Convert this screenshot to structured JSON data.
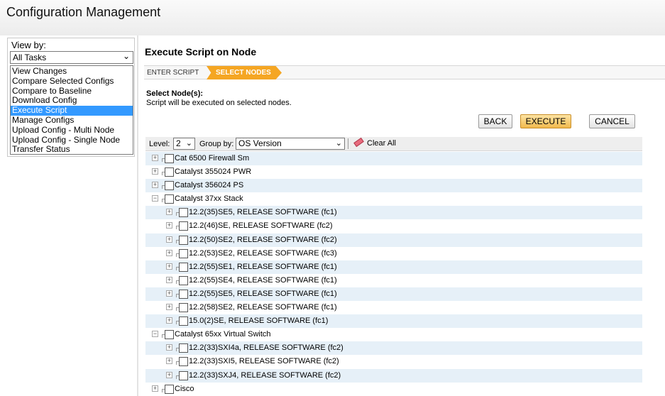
{
  "header": {
    "title": "Configuration Management"
  },
  "view_by": {
    "label": "View by:",
    "selected": "All Tasks",
    "items": [
      {
        "label": "View Changes",
        "selected": false
      },
      {
        "label": "Compare Selected Configs",
        "selected": false
      },
      {
        "label": "Compare to Baseline",
        "selected": false
      },
      {
        "label": "Download Config",
        "selected": false
      },
      {
        "label": "Execute Script",
        "selected": true
      },
      {
        "label": "Manage Configs",
        "selected": false
      },
      {
        "label": "Upload Config - Multi Node",
        "selected": false
      },
      {
        "label": "Upload Config - Single Node",
        "selected": false
      },
      {
        "label": "Transfer Status",
        "selected": false
      }
    ]
  },
  "main": {
    "title": "Execute Script on Node",
    "steps": [
      "ENTER SCRIPT",
      "SELECT NODES"
    ],
    "select_heading": "Select Node(s):",
    "select_sub": "Script will be executed on selected nodes.",
    "buttons": {
      "back": "BACK",
      "execute": "EXECUTE",
      "cancel": "CANCEL"
    },
    "toolbar": {
      "level_label": "Level:",
      "level_value": "2",
      "group_label": "Group by:",
      "group_value": "OS Version",
      "clear_label": "Clear All"
    }
  },
  "tree": [
    {
      "label": "Cat 6500 Firewall Sm",
      "level": 0,
      "expanded": false
    },
    {
      "label": "Catalyst 355024 PWR",
      "level": 0,
      "expanded": false
    },
    {
      "label": "Catalyst 356024 PS",
      "level": 0,
      "expanded": false
    },
    {
      "label": "Catalyst 37xx Stack",
      "level": 0,
      "expanded": true
    },
    {
      "label": "12.2(35)SE5, RELEASE SOFTWARE (fc1)",
      "level": 1,
      "expanded": false
    },
    {
      "label": "12.2(46)SE, RELEASE SOFTWARE (fc2)",
      "level": 1,
      "expanded": false
    },
    {
      "label": "12.2(50)SE2, RELEASE SOFTWARE (fc2)",
      "level": 1,
      "expanded": false
    },
    {
      "label": "12.2(53)SE2, RELEASE SOFTWARE (fc3)",
      "level": 1,
      "expanded": false
    },
    {
      "label": "12.2(55)SE1, RELEASE SOFTWARE (fc1)",
      "level": 1,
      "expanded": false
    },
    {
      "label": "12.2(55)SE4, RELEASE SOFTWARE (fc1)",
      "level": 1,
      "expanded": false
    },
    {
      "label": "12.2(55)SE5, RELEASE SOFTWARE (fc1)",
      "level": 1,
      "expanded": false
    },
    {
      "label": "12.2(58)SE2, RELEASE SOFTWARE (fc1)",
      "level": 1,
      "expanded": false
    },
    {
      "label": "15.0(2)SE, RELEASE SOFTWARE (fc1)",
      "level": 1,
      "expanded": false
    },
    {
      "label": "Catalyst 65xx Virtual Switch",
      "level": 0,
      "expanded": true
    },
    {
      "label": "12.2(33)SXI4a, RELEASE SOFTWARE (fc2)",
      "level": 1,
      "expanded": false
    },
    {
      "label": "12.2(33)SXI5, RELEASE SOFTWARE (fc2)",
      "level": 1,
      "expanded": false
    },
    {
      "label": "12.2(33)SXJ4, RELEASE SOFTWARE (fc2)",
      "level": 1,
      "expanded": false
    },
    {
      "label": "Cisco",
      "level": 0,
      "expanded": false
    }
  ],
  "icons": {
    "expand": "plus-icon",
    "collapse": "minus-icon",
    "dropdown": "chevron-down-icon",
    "clear": "eraser-icon"
  },
  "colors": {
    "accent": "#f5a623",
    "selection": "#3399ff",
    "row_alt": "#e6f0f8"
  }
}
